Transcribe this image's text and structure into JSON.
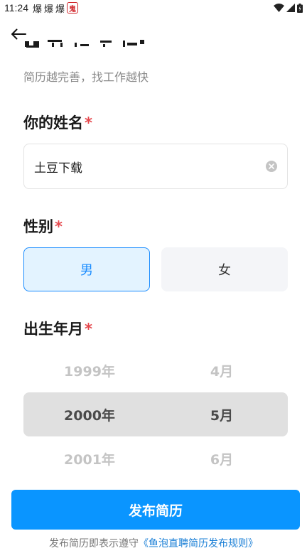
{
  "status_bar": {
    "time": "11:24",
    "notification_glyph": "爆",
    "badge_glyph": "鬼"
  },
  "page": {
    "subtitle": "简历越完善，找工作越快"
  },
  "name_section": {
    "label": "你的姓名",
    "required_mark": "*",
    "value": "土豆下载"
  },
  "gender_section": {
    "label": "性别",
    "required_mark": "*",
    "options": [
      "男",
      "女"
    ],
    "selected": "男"
  },
  "birth_section": {
    "label": "出生年月",
    "required_mark": "*",
    "rows": [
      {
        "year": "1999年",
        "month": "4月"
      },
      {
        "year": "2000年",
        "month": "5月"
      },
      {
        "year": "2001年",
        "month": "6月"
      }
    ]
  },
  "publish": {
    "label": "发布简历"
  },
  "footer": {
    "text": "发布简历即表示遵守",
    "link": "《鱼泡直聘简历发布规则》"
  },
  "colors": {
    "primary": "#0a95ff",
    "required": "#e5484d",
    "selected_bg": "#e3f3ff"
  }
}
